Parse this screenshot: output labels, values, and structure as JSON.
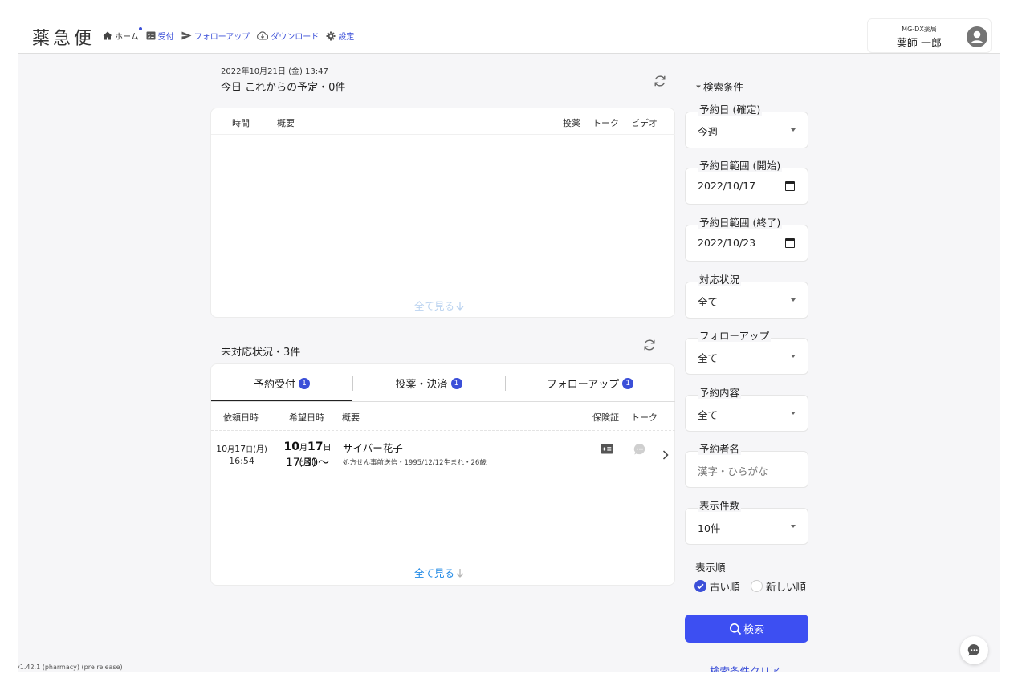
{
  "header": {
    "logo": "薬急便",
    "nav": [
      {
        "label": "ホーム",
        "icon": "home-icon"
      },
      {
        "label": "受付",
        "icon": "reception-icon"
      },
      {
        "label": "フォローアップ",
        "icon": "send-icon"
      },
      {
        "label": "ダウンロード",
        "icon": "cloud-download-icon"
      },
      {
        "label": "設定",
        "icon": "gear-icon"
      }
    ],
    "pharmacy_name": "MG-DX薬局",
    "user_name": "薬師 一郎"
  },
  "schedule": {
    "timestamp": "2022年10月21日 (金) 13:47",
    "title": "今日 これからの予定・0件",
    "columns": {
      "time": "時間",
      "summary": "概要",
      "medication": "投薬",
      "talk": "トーク",
      "video": "ビデオ"
    },
    "see_all": "全て見る"
  },
  "pending": {
    "title": "未対応状況・3件",
    "tabs": [
      {
        "label": "予約受付",
        "badge": "1"
      },
      {
        "label": "投薬・決済",
        "badge": "1"
      },
      {
        "label": "フォローアップ",
        "badge": "1"
      }
    ],
    "columns": {
      "request_date": "依頼日時",
      "desired_date": "希望日時",
      "summary": "概要",
      "insurance": "保険証",
      "talk": "トーク"
    },
    "rows": [
      {
        "req_m": "10",
        "req_mu": "月",
        "req_d": "17",
        "req_du": "日",
        "req_w": "(月)",
        "req_time": "16:54",
        "des_m": "10",
        "des_mu": "月",
        "des_d": "17",
        "des_du": "日",
        "des_w": "(月)",
        "des_time": "17:30〜",
        "name": "サイバー花子",
        "detail": "処方せん事前送信・1995/12/12生まれ・26歳"
      }
    ],
    "see_all": "全て見る"
  },
  "filters": {
    "title": "検索条件",
    "reservation_date": {
      "label": "予約日 (確定)",
      "value": "今週"
    },
    "range_start": {
      "label": "予約日範囲 (開始)",
      "value": "2022/10/17"
    },
    "range_end": {
      "label": "予約日範囲 (終了)",
      "value": "2022/10/23"
    },
    "status": {
      "label": "対応状況",
      "value": "全て"
    },
    "followup": {
      "label": "フォローアップ",
      "value": "全て"
    },
    "content": {
      "label": "予約内容",
      "value": "全て"
    },
    "name": {
      "label": "予約者名",
      "placeholder": "漢字・ひらがな"
    },
    "count": {
      "label": "表示件数",
      "value": "10件"
    },
    "sort": {
      "label": "表示順",
      "options": [
        "古い順",
        "新しい順"
      ],
      "selected": "古い順"
    },
    "search_button": "検索",
    "clear_link": "検索条件クリア"
  },
  "footer": {
    "version": "v1.42.1 (pharmacy) (pre release)"
  },
  "colors": {
    "accent": "#3d4ff2",
    "link": "#3b4fd8",
    "see_all": "#1e88e5",
    "background": "#f6f6f8"
  }
}
